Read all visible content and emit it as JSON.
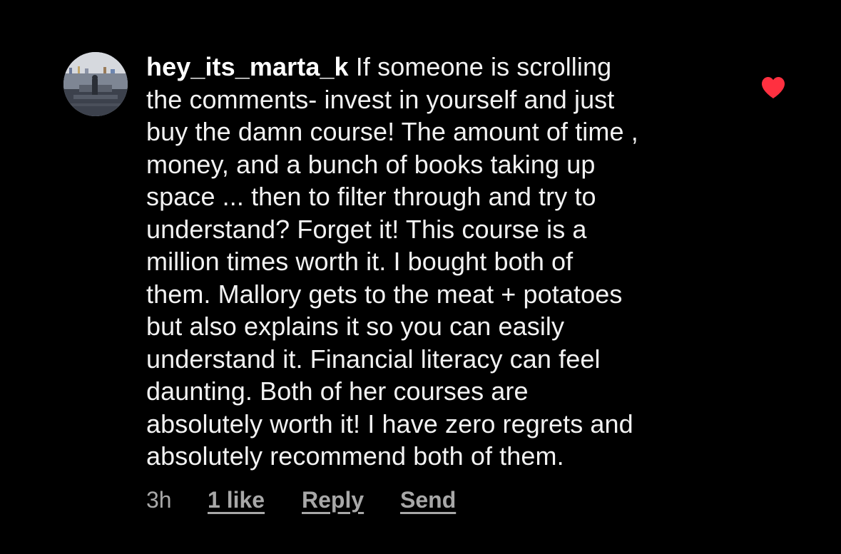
{
  "comment": {
    "username": "hey_its_marta_k",
    "text_lines": [
      " If someone is scrolling",
      "the comments- invest in yourself and just",
      "buy the damn course! The amount of time ,",
      "money, and a bunch of books taking up",
      "space ... then to filter through and try to",
      "understand? Forget it!  This course is a",
      "million times worth it. I bought both of",
      "them. Mallory gets to the meat + potatoes",
      "but also explains it so you can easily",
      "understand it.  Financial literacy can feel",
      "daunting.  Both of her courses are",
      "absolutely worth it! I have zero regrets and",
      "absolutely recommend both of them."
    ],
    "liked": true,
    "like_color": "#ff3040"
  },
  "actions": {
    "time": "3h",
    "likes": "1 like",
    "reply": "Reply",
    "send": "Send"
  },
  "icons": {
    "avatar": "profile-photo-avatar",
    "like": "heart-icon"
  }
}
